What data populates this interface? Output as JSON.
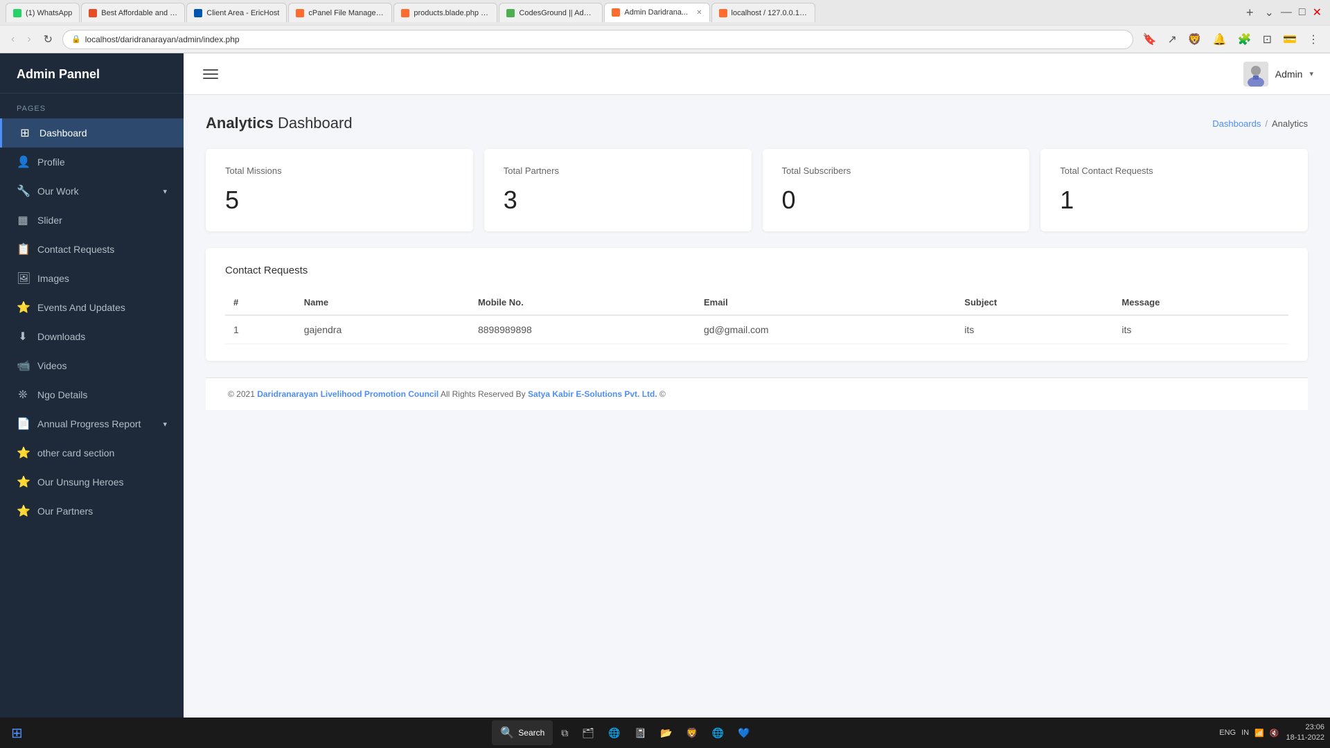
{
  "browser": {
    "tabs": [
      {
        "id": 1,
        "label": "(1) WhatsApp",
        "favicon_color": "#25D366",
        "active": false
      },
      {
        "id": 2,
        "label": "Best Affordable and R...",
        "favicon_color": "#e44d26",
        "active": false
      },
      {
        "id": 3,
        "label": "Client Area - EricHost",
        "favicon_color": "#0055b3",
        "active": false
      },
      {
        "id": 4,
        "label": "cPanel File Manager v...",
        "favicon_color": "#ff6c2f",
        "active": false
      },
      {
        "id": 5,
        "label": "products.blade.php - ...",
        "favicon_color": "#ff6c2f",
        "active": false
      },
      {
        "id": 6,
        "label": "CodesGround || Admi...",
        "favicon_color": "#4CAF50",
        "active": false
      },
      {
        "id": 7,
        "label": "Admin Daridrana...",
        "favicon_color": "#ff6c2f",
        "active": true
      },
      {
        "id": 8,
        "label": "localhost / 127.0.0.1 / ...",
        "favicon_color": "#ff6c2f",
        "active": false
      }
    ],
    "url": "localhost/daridranarayan/admin/index.php"
  },
  "sidebar": {
    "brand": "Admin Pannel",
    "section_label": "Pages",
    "items": [
      {
        "id": "dashboard",
        "label": "Dashboard",
        "icon": "⊞",
        "active": true
      },
      {
        "id": "profile",
        "label": "Profile",
        "icon": "👤",
        "active": false
      },
      {
        "id": "our-work",
        "label": "Our Work",
        "icon": "🔧",
        "active": false,
        "has_chevron": true
      },
      {
        "id": "slider",
        "label": "Slider",
        "icon": "▦",
        "active": false
      },
      {
        "id": "contact-requests",
        "label": "Contact Requests",
        "icon": "📋",
        "active": false
      },
      {
        "id": "images",
        "label": "Images",
        "icon": "🖼",
        "active": false
      },
      {
        "id": "events-updates",
        "label": "Events And Updates",
        "icon": "⭐",
        "active": false
      },
      {
        "id": "downloads",
        "label": "Downloads",
        "icon": "⬇",
        "active": false
      },
      {
        "id": "videos",
        "label": "Videos",
        "icon": "📹",
        "active": false
      },
      {
        "id": "ngo-details",
        "label": "Ngo Details",
        "icon": "❊",
        "active": false
      },
      {
        "id": "annual-progress",
        "label": "Annual Progress Report",
        "icon": "📄",
        "active": false,
        "has_chevron": true
      },
      {
        "id": "other-card",
        "label": "other card section",
        "icon": "⭐",
        "active": false
      },
      {
        "id": "unsung-heroes",
        "label": "Our Unsung Heroes",
        "icon": "⭐",
        "active": false
      },
      {
        "id": "our-partners",
        "label": "Our Partners",
        "icon": "⭐",
        "active": false
      }
    ]
  },
  "topbar": {
    "admin_label": "Admin",
    "admin_chevron": "▾"
  },
  "page": {
    "title_bold": "Analytics",
    "title_normal": " Dashboard",
    "breadcrumb": {
      "link_label": "Dashboards",
      "separator": "/",
      "current": "Analytics"
    }
  },
  "stats": [
    {
      "id": "total-missions",
      "label": "Total Missions",
      "value": "5"
    },
    {
      "id": "total-partners",
      "label": "Total Partners",
      "value": "3"
    },
    {
      "id": "total-subscribers",
      "label": "Total Subscribers",
      "value": "0"
    },
    {
      "id": "total-contact-requests",
      "label": "Total Contact Requests",
      "value": "1"
    }
  ],
  "contact_requests_table": {
    "title": "Contact Requests",
    "columns": [
      "#",
      "Name",
      "Mobile No.",
      "Email",
      "Subject",
      "Message"
    ],
    "rows": [
      {
        "num": "1",
        "name": "gajendra",
        "mobile": "8898989898",
        "email": "gd@gmail.com",
        "subject": "its",
        "message": "its"
      }
    ]
  },
  "footer": {
    "copy": "© 2021",
    "org_name": "Daridranarayan Livelihood Promotion Council",
    "rights_text": "All Rights Reserved By",
    "company": "Satya Kabir E-Solutions Pvt. Ltd.",
    "symbol": "©"
  },
  "taskbar": {
    "search_label": "Search",
    "apps": [
      {
        "id": "windows",
        "icon": "⊞"
      },
      {
        "id": "search",
        "label": "Search",
        "icon": "🔍"
      },
      {
        "id": "task-view",
        "icon": "⧉"
      },
      {
        "id": "file-manager",
        "icon": "📁"
      },
      {
        "id": "edge",
        "icon": "🌐"
      },
      {
        "id": "notepad",
        "icon": "📓"
      },
      {
        "id": "explorer",
        "icon": "📂"
      },
      {
        "id": "recycle",
        "icon": "🗑"
      },
      {
        "id": "brave",
        "icon": "🦁"
      },
      {
        "id": "chrome",
        "icon": "🌐"
      },
      {
        "id": "vscode",
        "icon": "💙"
      }
    ],
    "sys_tray": {
      "lang": "ENG",
      "region": "IN",
      "time": "23:06",
      "date": "18-11-2022"
    }
  }
}
